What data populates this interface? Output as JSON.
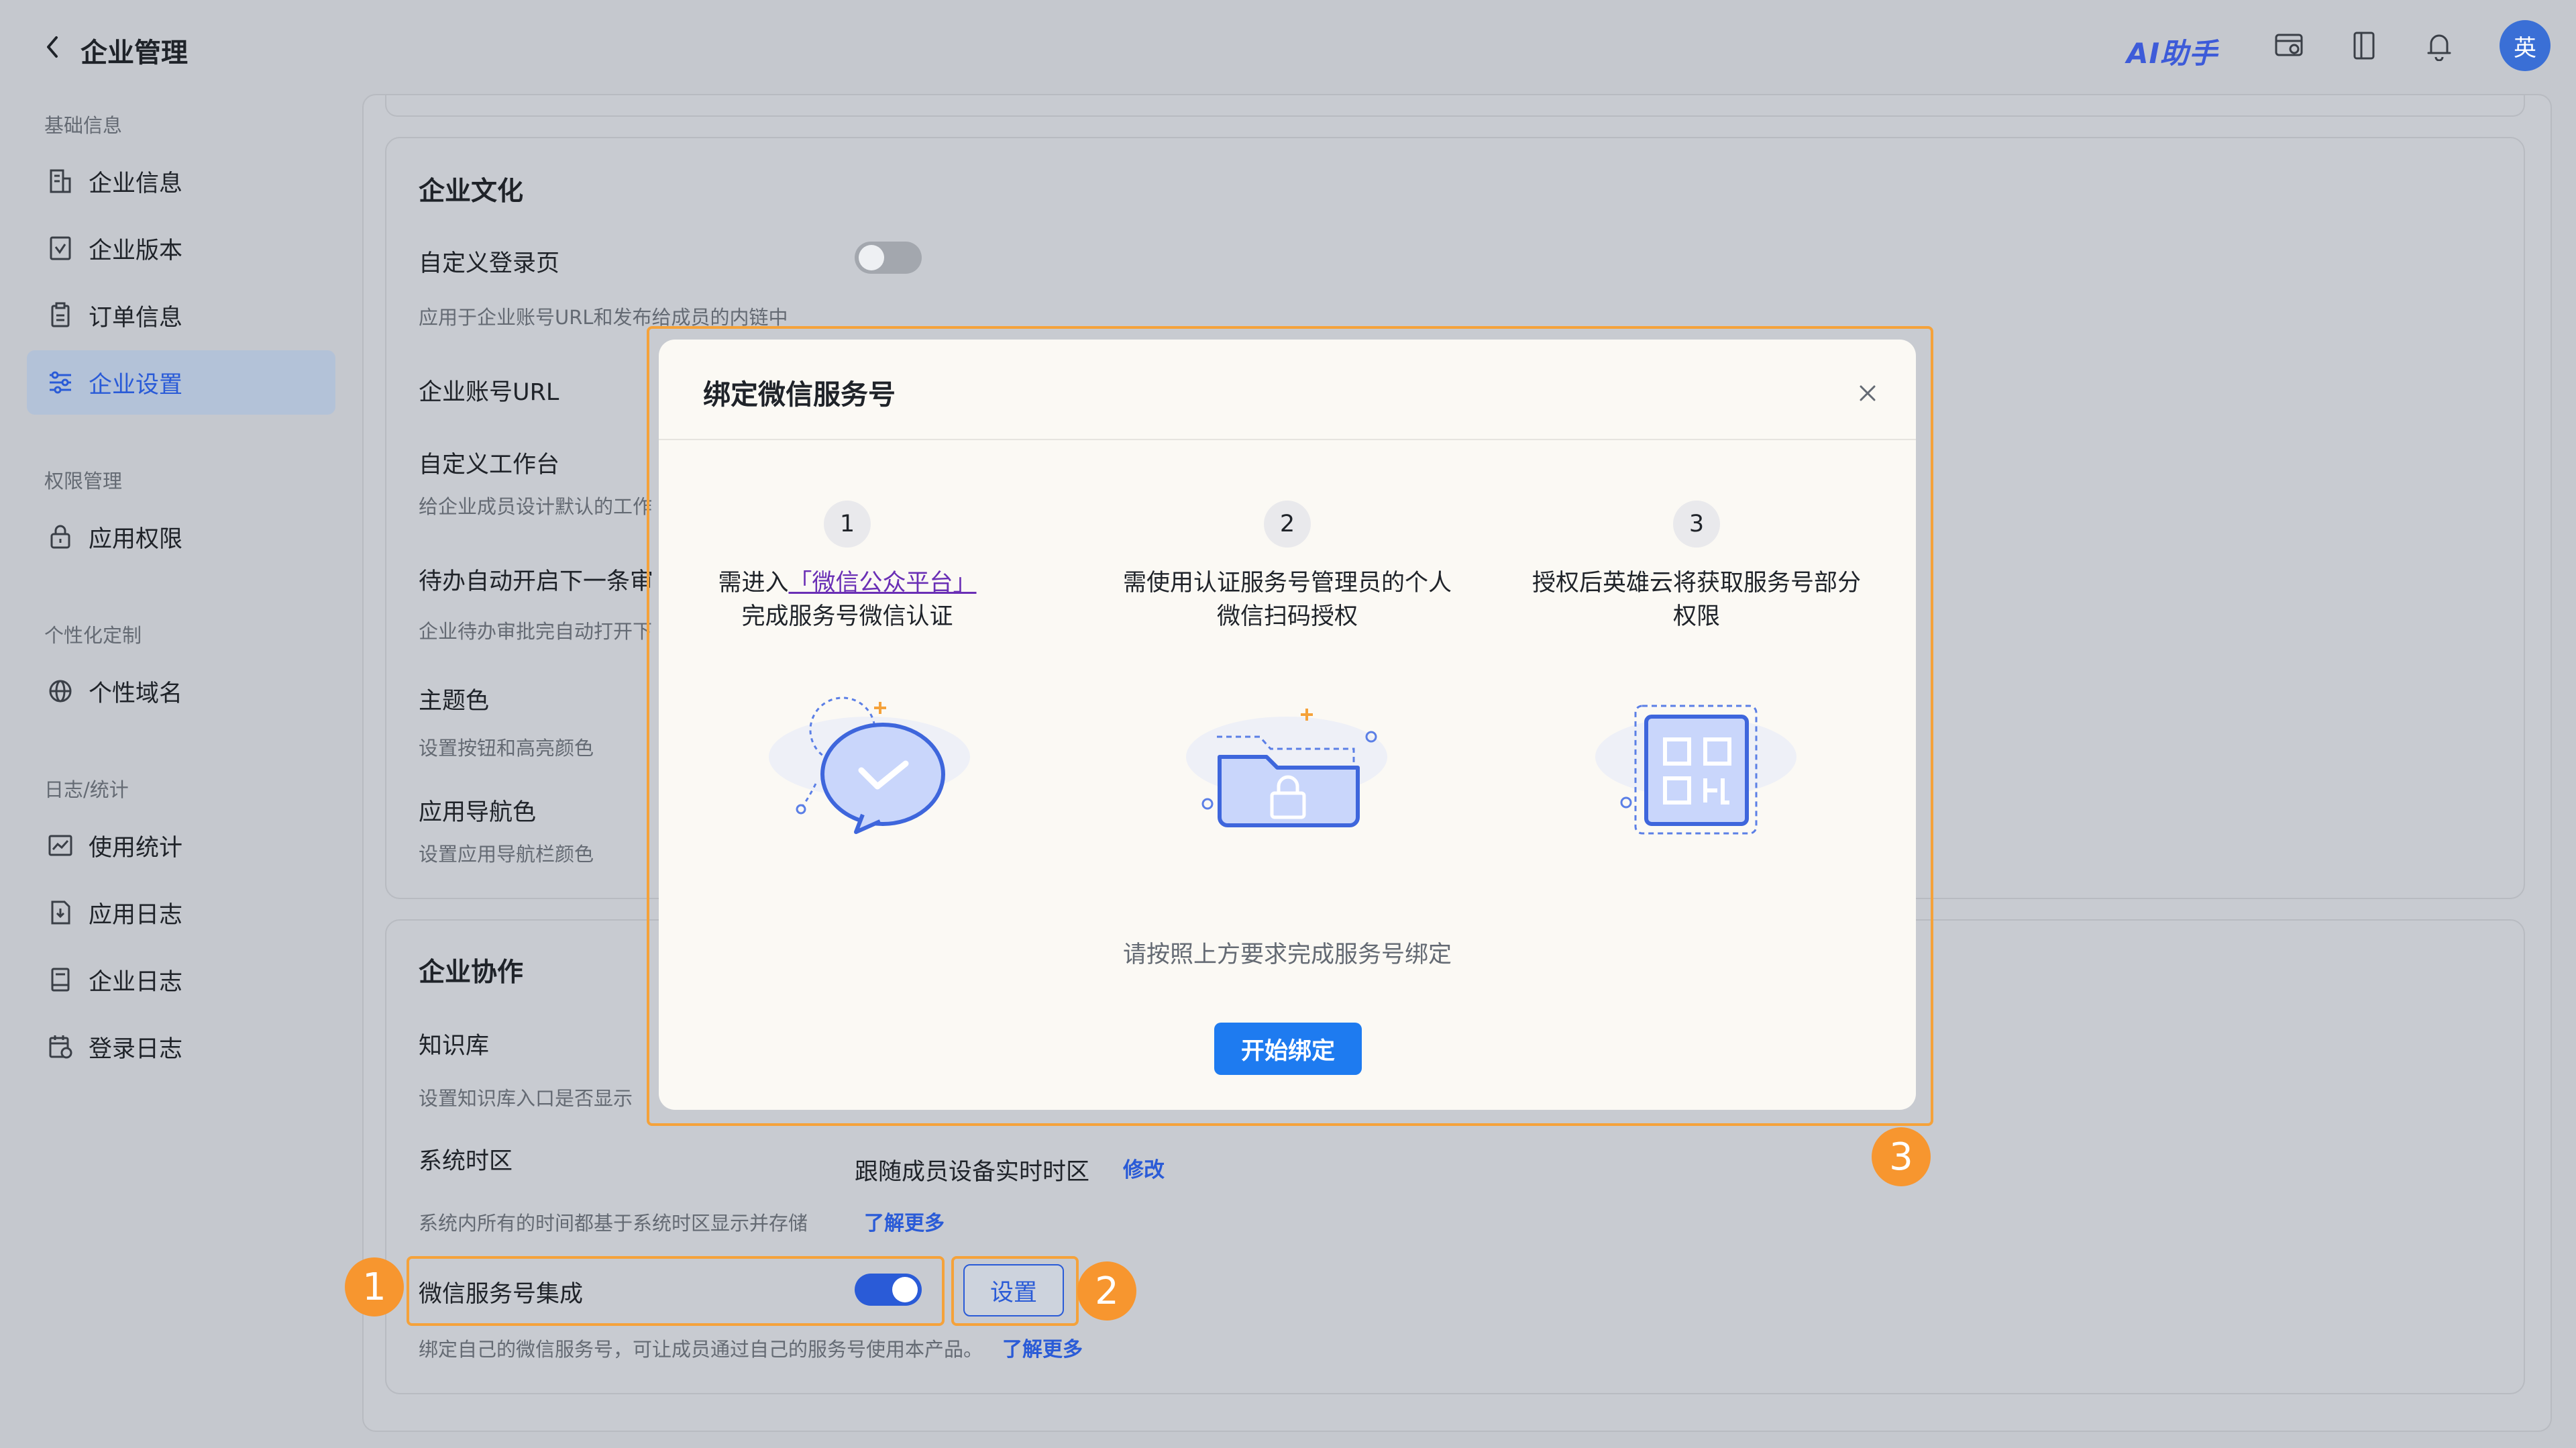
{
  "header": {
    "title": "企业管理",
    "ai_label": "AI助手",
    "avatar_text": "英"
  },
  "sidebar": {
    "groups": [
      {
        "label": "基础信息",
        "items": [
          {
            "label": "企业信息",
            "icon": "building-icon"
          },
          {
            "label": "企业版本",
            "icon": "version-icon"
          },
          {
            "label": "订单信息",
            "icon": "order-icon"
          },
          {
            "label": "企业设置",
            "icon": "settings-sliders-icon",
            "active": true
          }
        ]
      },
      {
        "label": "权限管理",
        "items": [
          {
            "label": "应用权限",
            "icon": "lock-icon"
          }
        ]
      },
      {
        "label": "个性化定制",
        "items": [
          {
            "label": "个性域名",
            "icon": "globe-icon"
          }
        ]
      },
      {
        "label": "日志/统计",
        "items": [
          {
            "label": "使用统计",
            "icon": "chart-icon"
          },
          {
            "label": "应用日志",
            "icon": "app-log-icon"
          },
          {
            "label": "企业日志",
            "icon": "book-icon"
          },
          {
            "label": "登录日志",
            "icon": "calendar-log-icon"
          }
        ]
      }
    ]
  },
  "culture": {
    "title": "企业文化",
    "custom_login": {
      "label": "自定义登录页",
      "desc": "应用于企业账号URL和发布给成员的内链中",
      "enabled": false
    },
    "account_url": {
      "label": "企业账号URL"
    },
    "workbench": {
      "label": "自定义工作台",
      "desc": "给企业成员设计默认的工作"
    },
    "todo": {
      "label": "待办自动开启下一条审",
      "desc": "企业待办审批完自动打开下"
    },
    "theme": {
      "label": "主题色",
      "desc": "设置按钮和高亮颜色"
    },
    "navcolor": {
      "label": "应用导航色",
      "desc": "设置应用导航栏颜色"
    }
  },
  "collab": {
    "title": "企业协作",
    "kb": {
      "label": "知识库",
      "desc": "设置知识库入口是否显示"
    },
    "tz": {
      "label": "系统时区",
      "desc": "系统内所有的时间都基于系统时区显示并存储",
      "learn_more": "了解更多",
      "value": "跟随成员设备实时时区",
      "edit": "修改"
    },
    "wechat": {
      "label": "微信服务号集成",
      "enabled": true,
      "settings_btn": "设置",
      "desc": "绑定自己的微信服务号，可让成员通过自己的服务号使用本产品。",
      "learn_more": "了解更多"
    }
  },
  "modal": {
    "title": "绑定微信服务号",
    "steps": [
      {
        "num": "1",
        "pre": "需进入",
        "link": "「微信公众平台」",
        "post": "完成服务号微信认证"
      },
      {
        "num": "2",
        "text": "需使用认证服务号管理员的个人微信扫码授权"
      },
      {
        "num": "3",
        "text": "授权后英雄云将获取服务号部分权限"
      }
    ],
    "hint": "请按照上方要求完成服务号绑定",
    "primary": "开始绑定"
  },
  "annotations": {
    "badge1": "1",
    "badge2": "2",
    "badge3": "3"
  },
  "colors": {
    "accent": "#2a5bd7",
    "annotation": "#f7962f",
    "primary_button": "#1e7bf0"
  }
}
